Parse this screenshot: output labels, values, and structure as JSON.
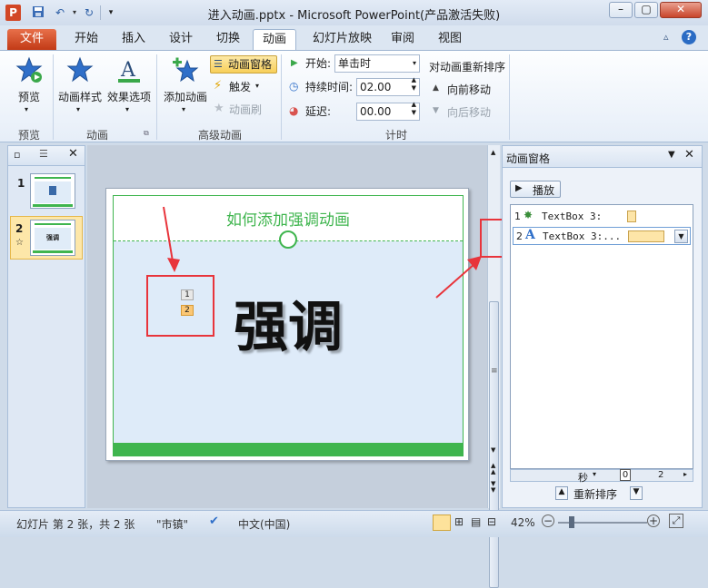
{
  "window": {
    "title": "进入动画.pptx - Microsoft PowerPoint(产品激活失败)",
    "logo": "P"
  },
  "tabs": [
    "文件",
    "开始",
    "插入",
    "设计",
    "切换",
    "动画",
    "幻灯片放映",
    "审阅",
    "视图"
  ],
  "ribbon": {
    "preview": "预览",
    "preview_group": "预览",
    "anim_style": "动画样式",
    "effect_options": "效果选项",
    "anim_group": "动画",
    "add_anim": "添加动画",
    "anim_pane": "动画窗格",
    "trigger": "触发",
    "anim_painter": "动画刷",
    "advanced_group": "高级动画",
    "start_label": "开始:",
    "start_value": "单击时",
    "duration_label": "持续时间:",
    "duration_value": "02.00",
    "delay_label": "延迟:",
    "delay_value": "00.00",
    "reorder_label": "对动画重新排序",
    "move_earlier": "向前移动",
    "move_later": "向后移动",
    "timing_group": "计时"
  },
  "slides": [
    {
      "num": "1"
    },
    {
      "num": "2",
      "thumb_text": "强调"
    }
  ],
  "slide": {
    "title": "如何添加强调动画",
    "body": "强调",
    "tag1": "1",
    "tag2": "2"
  },
  "pane": {
    "title": "动画窗格",
    "play": "播放",
    "items": [
      {
        "num": "1",
        "text": "TextBox 3:"
      },
      {
        "num": "2",
        "text": "TextBox 3:..."
      }
    ],
    "timeline_sec": "秒",
    "timeline_0": "0",
    "timeline_2": "2",
    "reorder": "重新排序"
  },
  "status": {
    "slide": "幻灯片 第 2 张，共 2 张",
    "theme": "\"市镇\"",
    "lang": "中文(中国)",
    "zoom": "42%"
  },
  "colors": {
    "accent_green": "#3fb54e",
    "file_tab": "#d24726",
    "annotation_red": "#e8343b"
  }
}
